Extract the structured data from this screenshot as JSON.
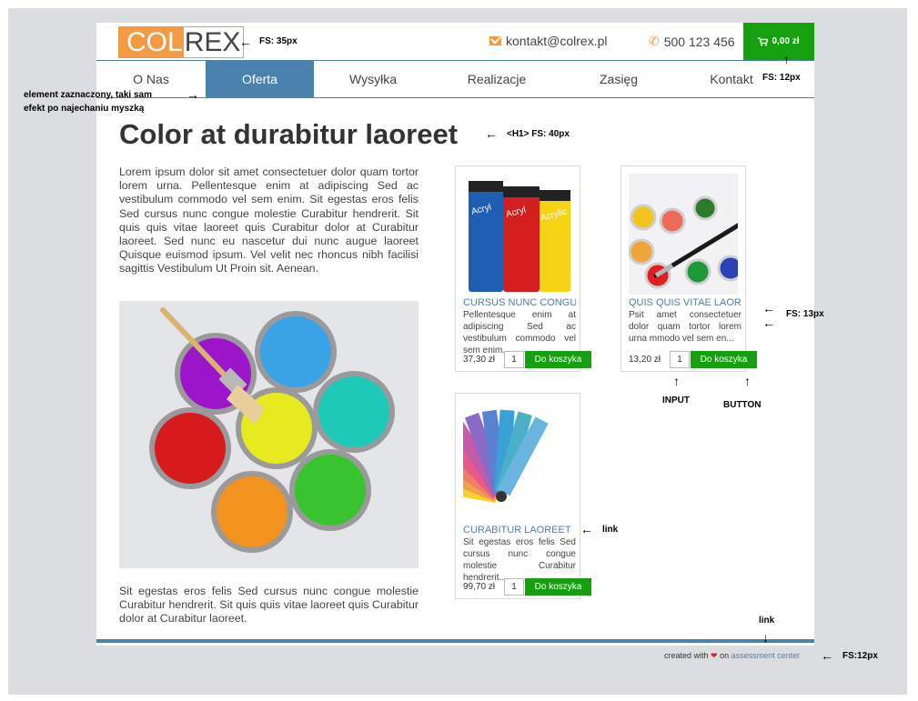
{
  "header": {
    "logo_part1": "COL",
    "logo_part2": "REX",
    "email": "kontakt@colrex.pl",
    "phone": "500 123 456",
    "cart_total": "0,00 zł"
  },
  "nav": {
    "items": [
      {
        "label": "O Nas"
      },
      {
        "label": "Oferta"
      },
      {
        "label": "Wysyłka"
      },
      {
        "label": "Realizacje"
      },
      {
        "label": "Zasięg"
      },
      {
        "label": "Kontakt"
      }
    ],
    "active": "Oferta"
  },
  "main": {
    "title": "Color at durabitur laoreet",
    "lead": "Lorem ipsum dolor sit amet consectetuer dolor quam tortor lorem urna. Pellentesque enim at adipiscing Sed ac vestibulum commodo vel sem enim. Sit egestas eros felis Sed cursus nunc congue molestie Curabitur hendrerit. Sit quis quis vitae laoreet quis Curabitur dolor at Curabitur laoreet. Sed nunc eu nascetur dui nunc augue laoreet Quisque euismod ipsum. Vel velit nec rhoncus nibh facilisi sagittis Vestibulum Ut Proin sit. Aenean.",
    "tail": "Sit egestas eros felis Sed cursus nunc congue molestie Curabitur hendrerit. Sit quis quis vitae laoreet quis Curabitur dolor at Curabitur laoreet."
  },
  "products": [
    {
      "title": "CURSUS NUNC CONGUE",
      "desc": "Pellentesque enim at adipiscing Sed ac vestibulum commodo vel sem enim...",
      "price": "37,30 zł",
      "qty": "1",
      "button": "Do koszyka"
    },
    {
      "title": "QUIS QUIS VITAE LAOREET",
      "desc": "Psit amet consectetuer dolor quam tortor lorem urna mmodo vel sem en...",
      "price": "13,20 zł",
      "qty": "1",
      "button": "Do koszyka"
    },
    {
      "title": "CURABITUR LAOREET",
      "desc": "Sit egestas eros felis Sed cursus nunc congue molestie Curabitur hendrerit...",
      "price": "99,70 zł",
      "qty": "1",
      "button": "Do koszyka"
    }
  ],
  "footer": {
    "text1": "created with",
    "text2": "on",
    "link": "assessment center"
  },
  "annotations": {
    "fs35": "FS: 35px",
    "fs12_cart": "FS: 12px",
    "hover_line1": "element zaznaczony, taki sam",
    "hover_line2": "efekt po najechaniu myszką",
    "h1": "<H1> FS: 40px",
    "fs13": "FS: 13px",
    "input": "INPUT",
    "button": "BUTTON",
    "link_card": "link",
    "link_footer": "link",
    "fs12_footer": "FS:12px"
  },
  "colors": {
    "accent_orange": "#f39a44",
    "nav_blue": "#4a82ad",
    "cart_green": "#16a010",
    "heart_red": "#e02020"
  },
  "icons": [
    "mail-icon",
    "phone-icon",
    "cart-icon",
    "heart-icon"
  ]
}
